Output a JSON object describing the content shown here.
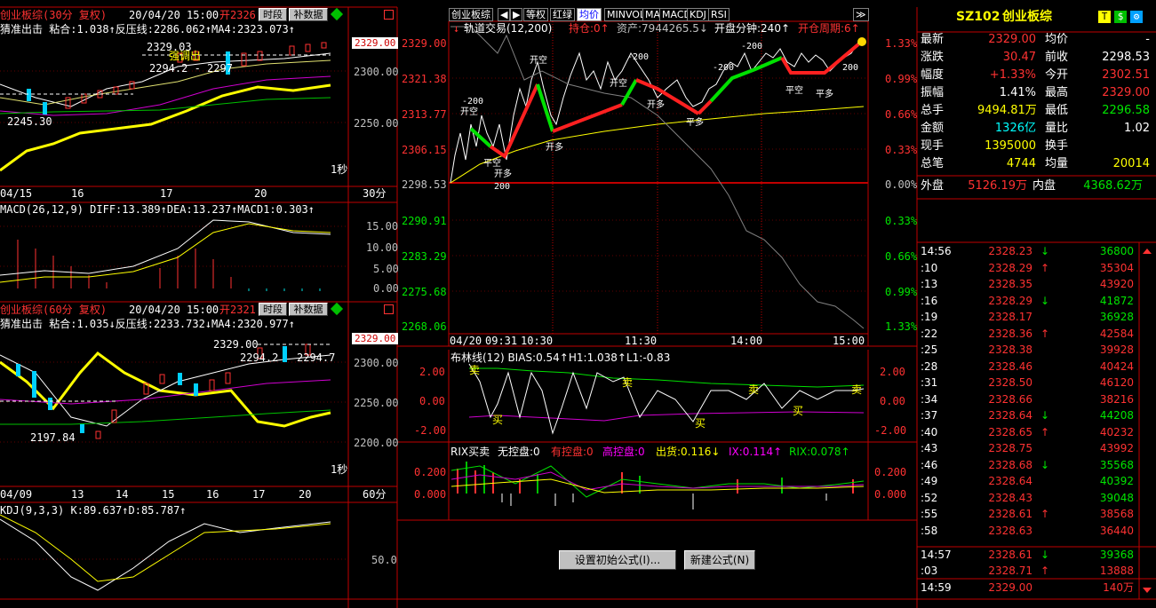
{
  "colors": {
    "up": "#ff3232",
    "down": "#00e600",
    "grid": "#c00000",
    "bg": "#000000",
    "ma": "#ffff00"
  },
  "left_panel": {
    "chart30": {
      "title": "创业板综(30分 复权)",
      "date": "20/04/20 15:00",
      "open_label": "开2326",
      "btn_time": "时段",
      "btn_fill": "补数据",
      "subtitle": "猜准出击 粘合:1.038↑反压线:2286.062↑MA4:2323.073↑",
      "price_box": "2329.00",
      "y_ticks": [
        "2300.00",
        "2250.00"
      ],
      "annotations": [
        "2329.03",
        "2294.2 - 2297",
        "2245.30",
        "强调出",
        "1秒"
      ],
      "x_ticks": [
        "04/15",
        "16",
        "17",
        "20"
      ],
      "period": "30分"
    },
    "macd": {
      "title": "MACD(26,12,9) DIFF:13.389↑DEA:13.237↑MACD1:0.303↑",
      "y_ticks": [
        "15.00",
        "10.00",
        "5.00",
        "0.00"
      ]
    },
    "chart60": {
      "title": "创业板综(60分 复权)",
      "date": "20/04/20 15:00",
      "open_label": "开2321",
      "btn_time": "时段",
      "btn_fill": "补数据",
      "subtitle": "猜准出击 粘合:1.035↓反压线:2233.732↓MA4:2320.977↑",
      "price_box": "2329.00",
      "y_ticks": [
        "2300.00",
        "2250.00",
        "2200.00"
      ],
      "annotations": [
        "2329.00",
        "2294.2",
        "2294.7",
        "2197.84",
        "1秒"
      ],
      "x_ticks": [
        "04/09",
        "13",
        "14",
        "15",
        "16",
        "17",
        "20"
      ],
      "period": "60分"
    },
    "kdj": {
      "title": "KDJ(9,3,3) K:89.637↑D:85.787↑",
      "y_ticks": [
        "50.0"
      ]
    }
  },
  "middle_panel": {
    "tabs": [
      "创业板综",
      "◀",
      "▶",
      "等权",
      "红绿",
      "均价",
      "MINVOL",
      "MA",
      "MACD",
      "KDJ",
      "RSI"
    ],
    "expand": "≫",
    "info": {
      "title": "轨道交易(12,200)",
      "hold_label": "持仓:0↑",
      "asset_label": "资产:7944265.5↓",
      "open_min": "开盘分钟:240↑",
      "open_cycle": "开仓周期:6↑"
    },
    "left_ticks": [
      "2329.00",
      "2321.38",
      "2313.77",
      "2306.15",
      "2298.53",
      "2290.91",
      "2283.29",
      "2275.68",
      "2268.06"
    ],
    "right_ticks": [
      "1.33%",
      "0.99%",
      "0.66%",
      "0.33%",
      "0.00%",
      "0.33%",
      "0.66%",
      "0.99%",
      "1.33%"
    ],
    "x_ticks": [
      "04/20",
      "09:31",
      "10:30",
      "11:30",
      "14:00",
      "15:00"
    ],
    "signals": [
      "开空",
      "开多",
      "平空",
      "平多",
      "-200",
      "200"
    ],
    "boll": {
      "title": "布林线(12) BIAS:0.54↑H1:1.038↑L1:-0.83",
      "y_ticks": [
        "2.00",
        "0.00",
        "-2.00"
      ],
      "marks": [
        "卖",
        "买"
      ]
    },
    "rix": {
      "title": "RIX买卖",
      "parts": [
        "无控盘:0",
        "有控盘:0",
        "高控盘:0",
        "出货:0.116↓",
        "IX:0.114↑",
        "RIX:0.078↑"
      ],
      "y_ticks": [
        "0.200",
        "0.000"
      ]
    },
    "buttons": {
      "reset": "设置初始公式(I)...",
      "new": "新建公式(N)"
    }
  },
  "right_panel": {
    "code": "SZ102",
    "name": "创业板综",
    "badges": [
      "T",
      "$",
      "⚙"
    ],
    "quote": [
      [
        "最新",
        "2329.00",
        "均价",
        "-"
      ],
      [
        "涨跌",
        "30.47",
        "前收",
        "2298.53"
      ],
      [
        "幅度",
        "+1.33%",
        "今开",
        "2302.51"
      ],
      [
        "振幅",
        "1.41%",
        "最高",
        "2329.00"
      ],
      [
        "总手",
        "9494.81万",
        "最低",
        "2296.58"
      ],
      [
        "金额",
        "1326亿",
        "量比",
        "1.02"
      ],
      [
        "现手",
        "1395000",
        "换手",
        ""
      ],
      [
        "总笔",
        "4744",
        "均量",
        "20014"
      ]
    ],
    "outer": {
      "label": "外盘",
      "value": "5126.19万",
      "inner_label": "内盘",
      "inner_value": "4368.62万"
    },
    "ticks": [
      {
        "time": "14:56",
        "price": "2328.23",
        "dir": "↓",
        "vol": "36800",
        "c": "down"
      },
      {
        "time": ":10",
        "price": "2328.29",
        "dir": "↑",
        "vol": "35304",
        "c": "up"
      },
      {
        "time": ":13",
        "price": "2328.35",
        "dir": "",
        "vol": "43920",
        "c": "up"
      },
      {
        "time": ":16",
        "price": "2328.29",
        "dir": "↓",
        "vol": "41872",
        "c": "down"
      },
      {
        "time": ":19",
        "price": "2328.17",
        "dir": "",
        "vol": "36928",
        "c": "down"
      },
      {
        "time": ":22",
        "price": "2328.36",
        "dir": "↑",
        "vol": "42584",
        "c": "up"
      },
      {
        "time": ":25",
        "price": "2328.38",
        "dir": "",
        "vol": "39928",
        "c": "up"
      },
      {
        "time": ":28",
        "price": "2328.46",
        "dir": "",
        "vol": "40424",
        "c": "up"
      },
      {
        "time": ":31",
        "price": "2328.50",
        "dir": "",
        "vol": "46120",
        "c": "up"
      },
      {
        "time": ":34",
        "price": "2328.66",
        "dir": "",
        "vol": "38216",
        "c": "up"
      },
      {
        "time": ":37",
        "price": "2328.64",
        "dir": "↓",
        "vol": "44208",
        "c": "down"
      },
      {
        "time": ":40",
        "price": "2328.65",
        "dir": "↑",
        "vol": "40232",
        "c": "up"
      },
      {
        "time": ":43",
        "price": "2328.75",
        "dir": "",
        "vol": "43992",
        "c": "up"
      },
      {
        "time": ":46",
        "price": "2328.68",
        "dir": "↓",
        "vol": "35568",
        "c": "down"
      },
      {
        "time": ":49",
        "price": "2328.64",
        "dir": "",
        "vol": "40392",
        "c": "down"
      },
      {
        "time": ":52",
        "price": "2328.43",
        "dir": "",
        "vol": "39048",
        "c": "down"
      },
      {
        "time": ":55",
        "price": "2328.61",
        "dir": "↑",
        "vol": "38568",
        "c": "up"
      },
      {
        "time": ":58",
        "price": "2328.63",
        "dir": "",
        "vol": "36440",
        "c": "up"
      },
      {
        "time": "14:57",
        "price": "2328.61",
        "dir": "↓",
        "vol": "39368",
        "c": "down"
      },
      {
        "time": ":03",
        "price": "2328.71",
        "dir": "↑",
        "vol": "13888",
        "c": "up"
      },
      {
        "time": "14:59",
        "price": "2329.00",
        "dir": "",
        "vol": "140万",
        "c": "up"
      }
    ]
  }
}
